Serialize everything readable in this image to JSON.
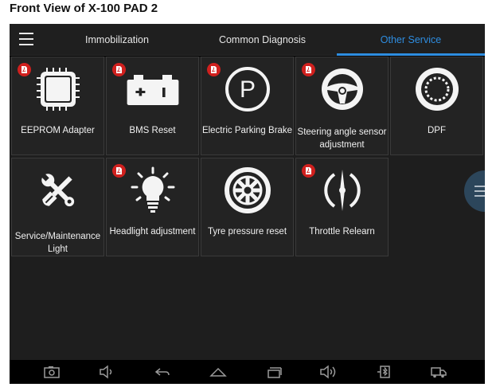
{
  "caption": "Front View of X-100 PAD 2",
  "header": {
    "tabs": [
      {
        "label": "Immobilization",
        "active": false
      },
      {
        "label": "Common Diagnosis",
        "active": false
      },
      {
        "label": "Other Service",
        "active": true
      }
    ]
  },
  "tiles": [
    {
      "label": "EEPROM Adapter",
      "icon": "chip-icon",
      "has_pdf": true
    },
    {
      "label": "BMS Reset",
      "icon": "battery-icon",
      "has_pdf": true
    },
    {
      "label": "Electric Parking Brake",
      "icon": "parking-brake-icon",
      "has_pdf": true
    },
    {
      "label": "Steering angle sensor adjustment",
      "icon": "steering-wheel-icon",
      "has_pdf": true
    },
    {
      "label": "DPF",
      "icon": "dpf-filter-icon",
      "has_pdf": false
    },
    {
      "label": "Service/Maintenance Light",
      "icon": "wrench-screwdriver-icon",
      "has_pdf": false
    },
    {
      "label": "Headlight adjustment",
      "icon": "headlight-bulb-icon",
      "has_pdf": true
    },
    {
      "label": "Tyre pressure reset",
      "icon": "tyre-icon",
      "has_pdf": false
    },
    {
      "label": "Throttle Relearn",
      "icon": "throttle-icon",
      "has_pdf": true
    }
  ],
  "navbar": [
    "screenshot-icon",
    "volume-down-icon",
    "back-icon",
    "home-icon",
    "recent-apps-icon",
    "volume-up-icon",
    "vci-connection-icon",
    "truck-icon"
  ],
  "colors": {
    "accent": "#2e8de0",
    "tile_bg": "#232323",
    "badge": "#d0201e"
  }
}
